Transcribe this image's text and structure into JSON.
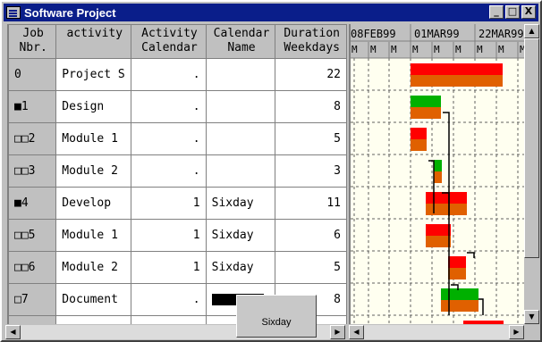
{
  "window": {
    "title": "Software Project",
    "minimize": "_",
    "maximize": "□",
    "close": "X"
  },
  "columns": [
    {
      "line1": "Job",
      "line2": "Nbr."
    },
    {
      "line1": "",
      "line2": "activity"
    },
    {
      "line1": "Activity",
      "line2": "Calendar"
    },
    {
      "line1": "Calendar",
      "line2": "Name"
    },
    {
      "line1": "Duration",
      "line2": "Weekdays"
    }
  ],
  "rows": [
    {
      "job": "0",
      "activity": "Project S",
      "act_cal": ".",
      "cal_name": "",
      "duration": "22"
    },
    {
      "job": "■1",
      "activity": "Design",
      "act_cal": ".",
      "cal_name": "",
      "duration": "8"
    },
    {
      "job": "□□2",
      "activity": "Module 1",
      "act_cal": ".",
      "cal_name": "",
      "duration": "5"
    },
    {
      "job": "□□3",
      "activity": "Module 2",
      "act_cal": ".",
      "cal_name": "",
      "duration": "3"
    },
    {
      "job": "■4",
      "activity": "Develop",
      "act_cal": "1",
      "cal_name": "Sixday",
      "duration": "11"
    },
    {
      "job": "□□5",
      "activity": "Module 1",
      "act_cal": "1",
      "cal_name": "Sixday",
      "duration": "6"
    },
    {
      "job": "□□6",
      "activity": "Module 2",
      "act_cal": "1",
      "cal_name": "Sixday",
      "duration": "5"
    },
    {
      "job": "□7",
      "activity": "Document",
      "act_cal": ".",
      "cal_name": "",
      "duration": "8"
    }
  ],
  "gantt": {
    "dates": [
      "08FEB99",
      "01MAR99",
      "22MAR99"
    ],
    "day_labels": [
      "M",
      "M",
      "M",
      "M",
      "M",
      "M",
      "M",
      "M",
      "M",
      "M"
    ],
    "colors": {
      "red": "#ff0000",
      "orange": "#e06000",
      "green": "#00b000",
      "background": "#fffff0"
    }
  },
  "popup": {
    "text": "Sixday"
  },
  "scroll": {
    "left_arrow": "◀",
    "right_arrow": "▶",
    "up_arrow": "▲",
    "down_arrow": "▼"
  }
}
